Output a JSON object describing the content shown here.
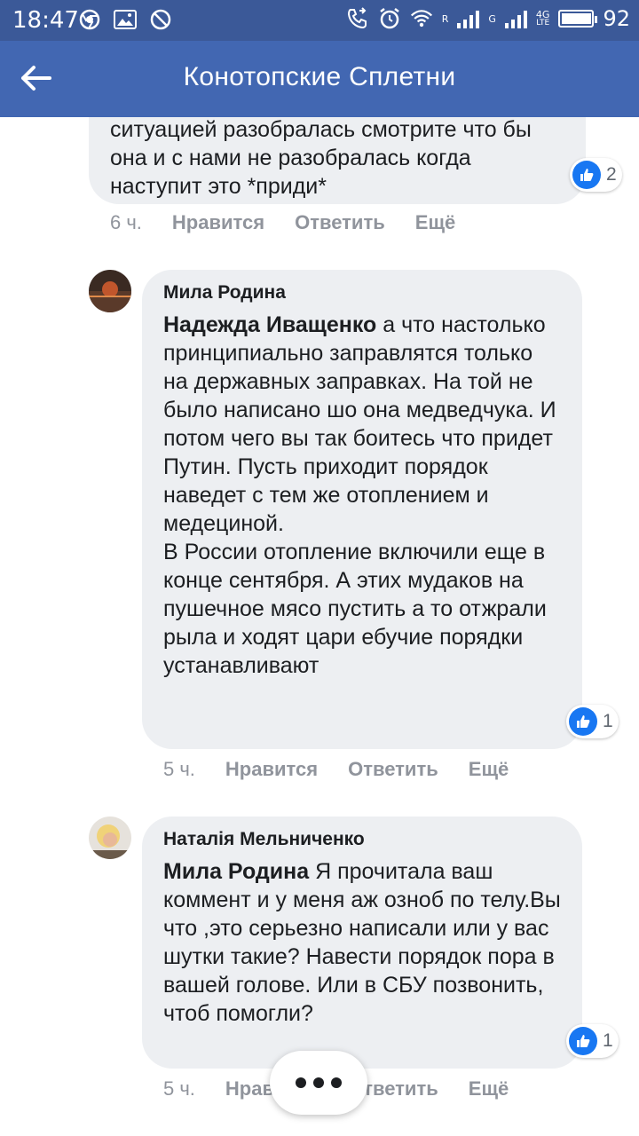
{
  "status_bar": {
    "time": "18:47",
    "signal_1_label": "R",
    "signal_2_label": "G",
    "network_top": "4G",
    "network_bottom": "LTE",
    "battery_percent": "92"
  },
  "app_bar": {
    "title": "Конотопские Сплетни"
  },
  "comments": [
    {
      "text": "ситуацией разобралась смотрите что бы она и с нами не разобралась когда наступит это *приди*",
      "likes": "2",
      "time": "6 ч.",
      "like_action": "Нравится",
      "reply_action": "Ответить",
      "more_action": "Ещё"
    },
    {
      "author": "Мила Родина",
      "mention": "Надежда Иващенко",
      "text": " а что настолько принципиально заправлятся только на державных заправках. На той не было написано шо она медведчука. И потом чего вы так боитесь что придет Путин. Пусть приходит порядок наведет с тем же отоплением и медециной.\nВ России отопление включили еще в конце сентября. А этих мудаков на пушечное мясо пустить а то отжрали рыла и ходят цари ебучие порядки устанавливают",
      "likes": "1",
      "time": "5 ч.",
      "like_action": "Нравится",
      "reply_action": "Ответить",
      "more_action": "Ещё"
    },
    {
      "author": "Наталія Мельниченко",
      "mention": "Мила Родина",
      "text": " Я прочитала ваш коммент и у меня аж озноб по телу.Вы что ,это серьезно написали или у вас шутки такие? Навести порядок пора в вашей голове. Или в СБУ позвонить, чтоб помогли?",
      "likes": "1",
      "time": "5 ч.",
      "like_action": "Нравится",
      "reply_action": "Ответить",
      "more_action": "Ещё"
    }
  ],
  "colors": {
    "status_bar": "#3b5998",
    "app_bar": "#4267b2",
    "bubble": "#edeff2",
    "like_blue": "#1877f2",
    "meta_text": "#90949c"
  }
}
